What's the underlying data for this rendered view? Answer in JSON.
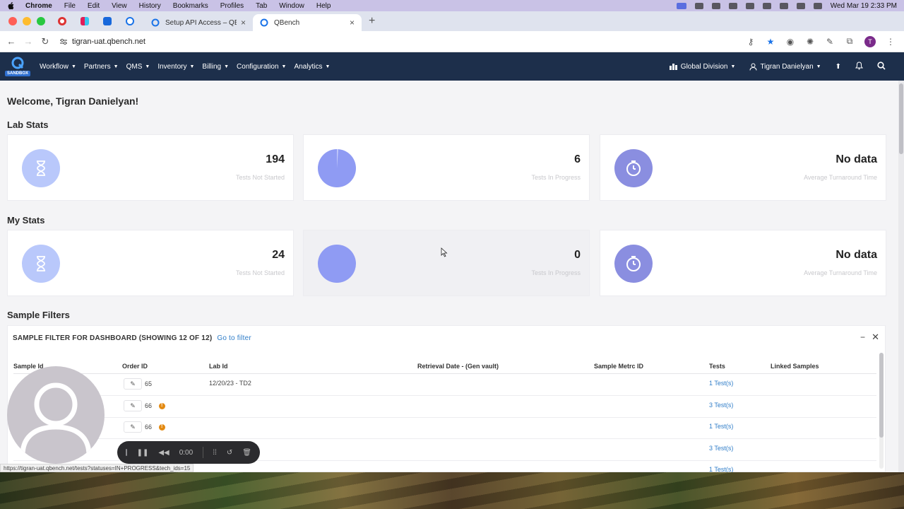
{
  "menubar": {
    "app": "Chrome",
    "items": [
      "File",
      "Edit",
      "View",
      "History",
      "Bookmarks",
      "Profiles",
      "Tab",
      "Window",
      "Help"
    ],
    "clock": "Wed Mar 19  2:33 PM"
  },
  "browser": {
    "tabs": [
      {
        "title": "Setup API Access – QBench"
      },
      {
        "title": "QBench"
      }
    ],
    "url": "tigran-uat.qbench.net",
    "profile_initial": "T"
  },
  "app": {
    "logo_badge": "SANDBOX",
    "nav": [
      "Workflow",
      "Partners",
      "QMS",
      "Inventory",
      "Billing",
      "Configuration",
      "Analytics"
    ],
    "division": "Global Division",
    "user": "Tigran Danielyan"
  },
  "welcome": "Welcome, Tigran Danielyan!",
  "lab_stats": {
    "title": "Lab Stats",
    "cards": [
      {
        "value": "194",
        "label": "Tests Not Started"
      },
      {
        "value": "6",
        "label": "Tests In Progress"
      },
      {
        "value": "No data",
        "label": "Average Turnaround Time"
      }
    ]
  },
  "my_stats": {
    "title": "My Stats",
    "cards": [
      {
        "value": "24",
        "label": "Tests Not Started"
      },
      {
        "value": "0",
        "label": "Tests In Progress"
      },
      {
        "value": "No data",
        "label": "Average Turnaround Time"
      }
    ]
  },
  "sample_filters": {
    "title": "Sample Filters",
    "panel_title": "SAMPLE FILTER FOR DASHBOARD (SHOWING 12 OF 12)",
    "go_link": "Go to filter",
    "columns": [
      "Sample Id",
      "Order ID",
      "Lab Id",
      "Retrieval Date - (Gen vault)",
      "Sample Metrc ID",
      "Tests",
      "Linked Samples"
    ],
    "rows": [
      {
        "order": "65",
        "lab_id": "12/20/23 - TD2",
        "tests": "1 Test(s)"
      },
      {
        "order": "66",
        "lab_id": "",
        "tests": "3 Test(s)"
      },
      {
        "order": "66",
        "lab_id": "",
        "tests": "1 Test(s)"
      },
      {
        "order": "",
        "lab_id": "",
        "tests": "3 Test(s)"
      },
      {
        "order": "",
        "lab_id": "",
        "tests": "1 Test(s)"
      }
    ]
  },
  "status_url": "https://tigran-uat.qbench.net/tests?statuses=IN+PROGRESS&tech_ids=15",
  "recorder": {
    "time": "0:00"
  }
}
